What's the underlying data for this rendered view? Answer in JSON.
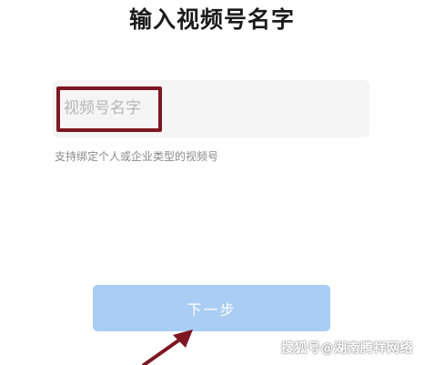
{
  "header": {
    "title": "输入视频号名字"
  },
  "form": {
    "name_input": {
      "placeholder": "视频号名字",
      "value": ""
    },
    "hint": "支持绑定个人或企业类型的视频号"
  },
  "actions": {
    "next_label": "下一步"
  },
  "watermark": {
    "text": "搜狐号@湖南腾祥网络"
  },
  "colors": {
    "highlight_box": "#7e1722",
    "next_button_bg": "#a9cdf3",
    "arrow": "#7e1722"
  }
}
